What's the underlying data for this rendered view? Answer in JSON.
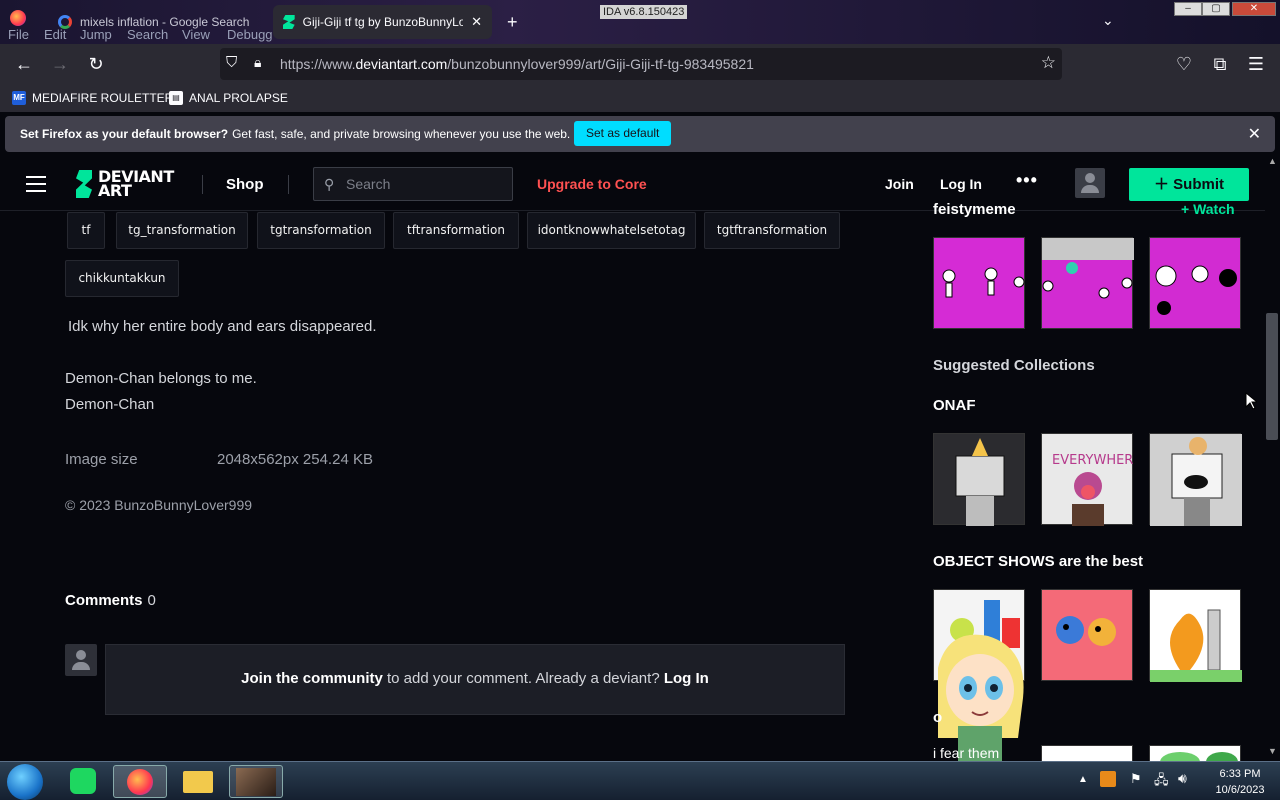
{
  "titlebar": {
    "menu": [
      "File",
      "Edit",
      "Jump",
      "Search",
      "View",
      "Debugg"
    ],
    "tabs": [
      {
        "label": "mixels inflation - Google Search"
      },
      {
        "label": "Giji-Giji tf tg by BunzoBunnyLo"
      }
    ],
    "ida_label": "IDA v6.8.150423"
  },
  "nav": {
    "url_prefix": "https://www.",
    "url_domain": "deviantart.com",
    "url_path": "/bunzobunnylover999/art/Giji-Giji-tf-tg-983495821"
  },
  "bookmarks": [
    {
      "label": "MEDIAFIRE ROULETTER"
    },
    {
      "label": "ANAL PROLAPSE"
    }
  ],
  "notice": {
    "bold": "Set Firefox as your default browser?",
    "text": "Get fast, safe, and private browsing whenever you use the web.",
    "button": "Set as default"
  },
  "header": {
    "logo_line1": "DEVIANT",
    "logo_line2": "ART",
    "shop": "Shop",
    "search_placeholder": "Search",
    "upgrade": "Upgrade to Core",
    "join": "Join",
    "login": "Log In",
    "more": "•••",
    "submit": "Submit"
  },
  "tags": [
    "tf",
    "tg_transformation",
    "tgtransformation",
    "tftransformation",
    "idontknowwhatelsetotag",
    "tgtftransformation",
    "chikkuntakkun"
  ],
  "description": {
    "line1": "Idk why her entire body and ears disappeared.",
    "line2": "Demon-Chan belongs to me.",
    "line3": "Demon-Chan"
  },
  "image_size": {
    "label": "Image size",
    "value": "2048x562px 254.24 KB"
  },
  "copyright": "© 2023 BunzoBunnyLover999",
  "comments": {
    "title": "Comments",
    "count": "0",
    "join_link": "Join the community",
    "middle": "to add your comment. Already a deviant?",
    "login_link": "Log In"
  },
  "sidebar": {
    "top_partial_title": "feistymeme",
    "watch": "+ Watch",
    "suggested_title": "Suggested Collections",
    "collections": [
      {
        "title": "ONAF"
      },
      {
        "title": "OBJECT SHOWS are the best"
      },
      {
        "title": "o"
      }
    ],
    "partial_text": "i fear them"
  },
  "taskbar": {
    "time": "6:33 PM",
    "date": "10/6/2023"
  }
}
